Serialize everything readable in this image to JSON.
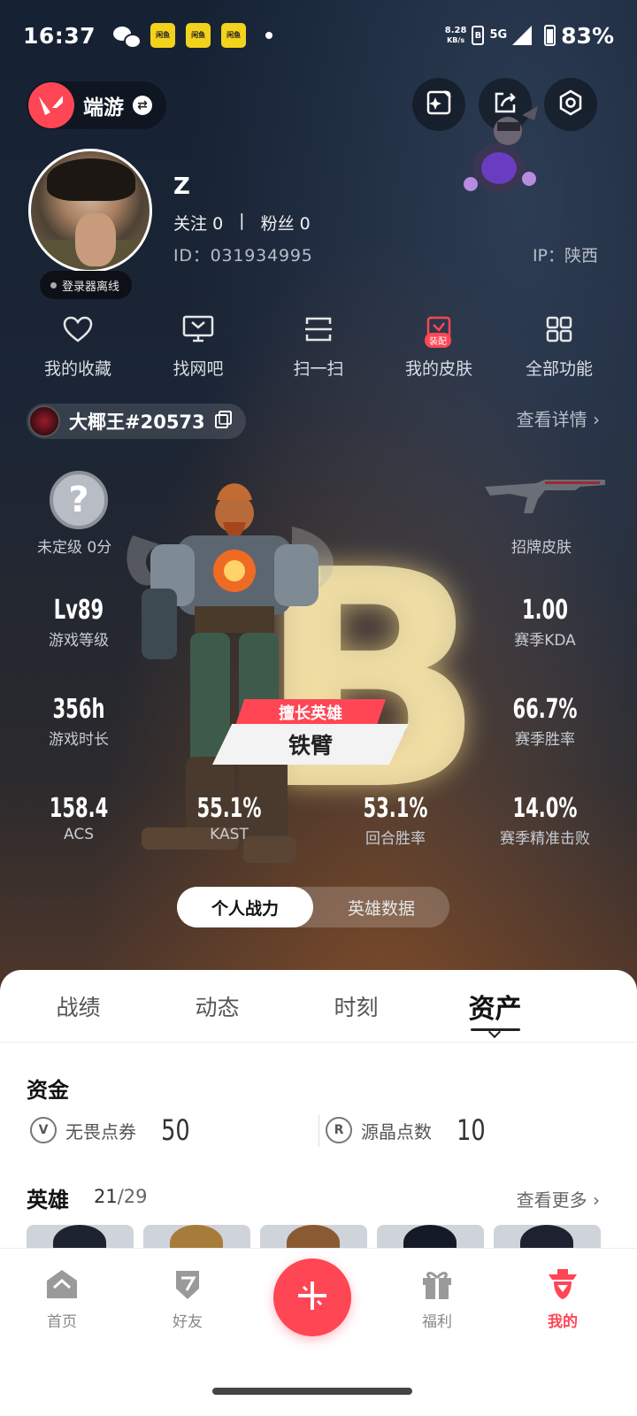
{
  "status_bar": {
    "time": "16:37",
    "app_badge_text": "闲鱼",
    "speed_value": "8.28",
    "speed_unit": "KB/s",
    "network": "5G",
    "battery": "83%"
  },
  "header": {
    "game_name": "端游",
    "icons": [
      "sparkle-edit-icon",
      "share-icon",
      "settings-hex-icon"
    ]
  },
  "profile": {
    "username": "Z",
    "follow_label": "关注",
    "follow_count": "0",
    "separator": "|",
    "fans_label": "粉丝",
    "fans_count": "0",
    "id": "ID：031934995",
    "ip": "IP：陕西",
    "status": "登录器离线"
  },
  "shortcuts": [
    {
      "label": "我的收藏",
      "icon": "heart-icon"
    },
    {
      "label": "找网吧",
      "icon": "monitor-icon"
    },
    {
      "label": "扫一扫",
      "icon": "scan-icon"
    },
    {
      "label": "我的皮肤",
      "icon": "skin-icon",
      "tag": "装配"
    },
    {
      "label": "全部功能",
      "icon": "grid-icon"
    }
  ],
  "player": {
    "name": "大椰王#20573",
    "view_detail": "查看详情"
  },
  "stats": {
    "rank_label": "未定级 0分",
    "showcase_skin": "招牌皮肤",
    "level_value": "Lv89",
    "level_label": "游戏等级",
    "kda_value": "1.00",
    "kda_label": "赛季KDA",
    "hours_value": "356h",
    "hours_label": "游戏时长",
    "winrate_value": "66.7%",
    "winrate_label": "赛季胜率",
    "acs_value": "158.4",
    "acs_label": "ACS",
    "kast_value": "55.1%",
    "kast_label": "KAST",
    "round_win_value": "53.1%",
    "round_win_label": "回合胜率",
    "precise_kill_value": "14.0%",
    "precise_kill_label": "赛季精准击败",
    "grade": "B",
    "best_hero_label": "擅长英雄",
    "best_hero_name": "铁臂"
  },
  "mode_toggle": {
    "personal": "个人战力",
    "heroes": "英雄数据",
    "active": "personal"
  },
  "tabs": [
    {
      "label": "战绩"
    },
    {
      "label": "动态"
    },
    {
      "label": "时刻"
    },
    {
      "label": "资产",
      "active": true
    }
  ],
  "assets": {
    "funds_title": "资金",
    "vp_label": "无畏点券",
    "vp_value": "50",
    "rp_label": "源晶点数",
    "rp_value": "10",
    "heroes_title": "英雄",
    "heroes_owned": "21",
    "heroes_total": "/29",
    "see_more": "查看更多"
  },
  "bottom_nav": [
    {
      "label": "首页",
      "icon": "home-icon"
    },
    {
      "label": "好友",
      "icon": "friends-icon"
    },
    {
      "label": "",
      "icon": "plus-icon"
    },
    {
      "label": "福利",
      "icon": "gift-icon"
    },
    {
      "label": "我的",
      "icon": "profile-agent-icon",
      "active": true
    }
  ],
  "colors": {
    "accent": "#ff4655",
    "sheet_bg": "#ffffff"
  }
}
